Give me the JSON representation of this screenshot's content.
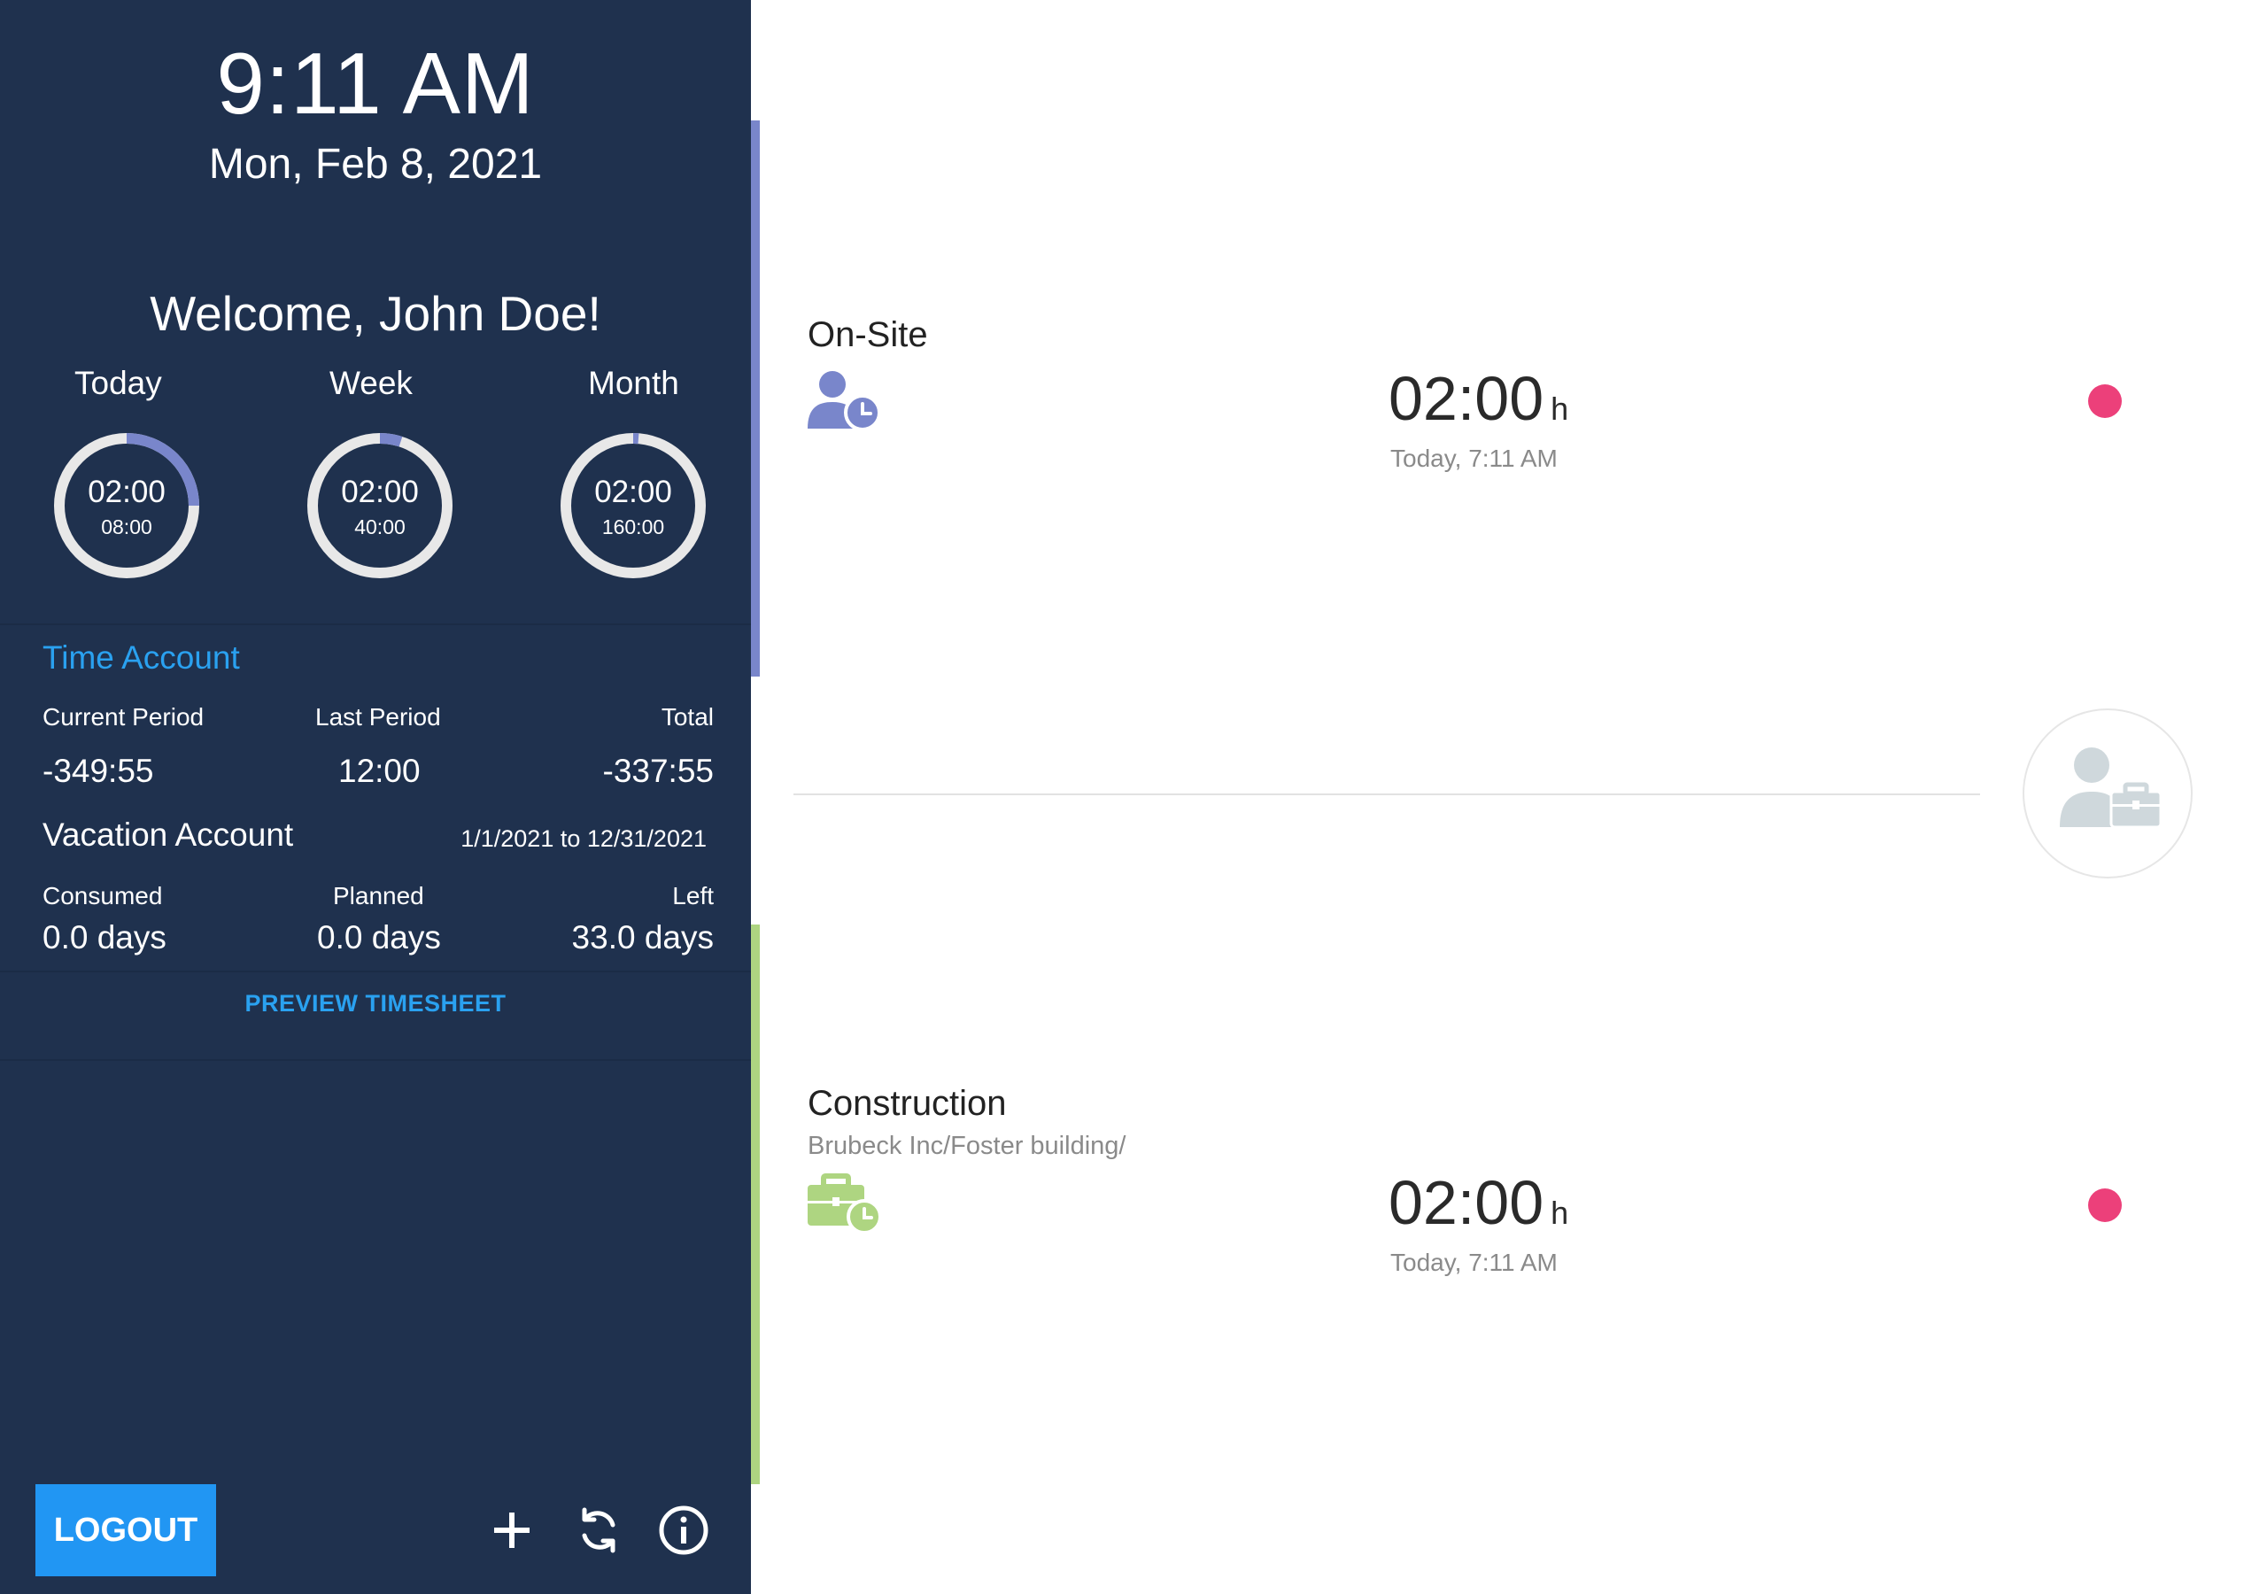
{
  "clock": {
    "time": "9:11 AM",
    "date": "Mon, Feb 8, 2021"
  },
  "welcome": "Welcome, John Doe!",
  "summary": [
    {
      "label": "Today",
      "worked": "02:00",
      "target": "08:00",
      "progress": 0.25
    },
    {
      "label": "Week",
      "worked": "02:00",
      "target": "40:00",
      "progress": 0.05
    },
    {
      "label": "Month",
      "worked": "02:00",
      "target": "160:00",
      "progress": 0.0125
    }
  ],
  "time_account": {
    "title": "Time Account",
    "current_label": "Current Period",
    "last_label": "Last Period",
    "total_label": "Total",
    "current_value": "-349:55",
    "last_value": "12:00",
    "total_value": "-337:55"
  },
  "vacation_account": {
    "title": "Vacation Account",
    "range": "1/1/2021 to 12/31/2021",
    "consumed_label": "Consumed",
    "planned_label": "Planned",
    "left_label": "Left",
    "consumed_value": "0.0 days",
    "planned_value": "0.0 days",
    "left_value": "33.0 days"
  },
  "preview_label": "PREVIEW TIMESHEET",
  "logout_label": "LOGOUT",
  "toolbar_icons": [
    "add-icon",
    "sync-icon",
    "info-icon"
  ],
  "entries": [
    {
      "title": "On-Site",
      "subtitle": "",
      "icon": "person-clock-icon",
      "duration": "02:00",
      "unit": "h",
      "when": "Today, 7:11 AM",
      "accent": "#7986cb"
    },
    {
      "title": "Construction",
      "subtitle": "Brubeck Inc/Foster building/",
      "icon": "briefcase-clock-icon",
      "duration": "02:00",
      "unit": "h",
      "when": "Today, 7:11 AM",
      "accent": "#aed581"
    }
  ],
  "colors": {
    "sidebar_bg": "#1f314e",
    "link_blue": "#2aa1f0",
    "ring_progress": "#7986cb",
    "ring_track": "#e8e8e8",
    "status_dot": "#ec407a",
    "logout_bg": "#2196f3"
  }
}
